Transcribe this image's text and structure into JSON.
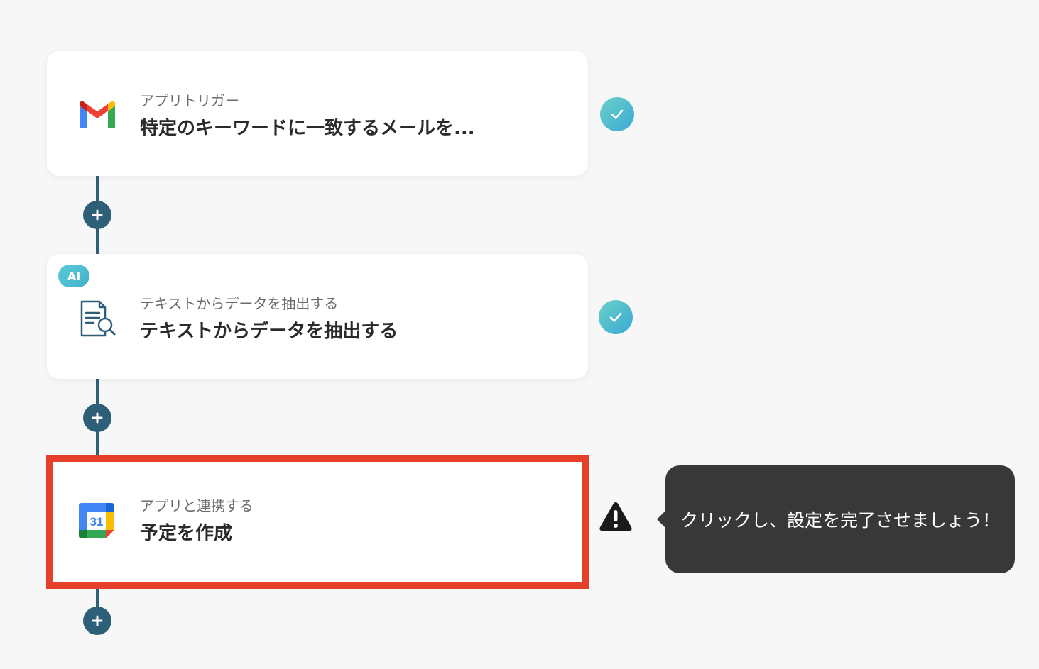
{
  "steps": [
    {
      "subtitle": "アプリトリガー",
      "title": "特定のキーワードに一致するメールを...",
      "app_icon": "gmail-icon",
      "status": "complete"
    },
    {
      "badge": "AI",
      "subtitle": "テキストからデータを抽出する",
      "title": "テキストからデータを抽出する",
      "app_icon": "document-search-icon",
      "status": "complete"
    },
    {
      "subtitle": "アプリと連携する",
      "title": "予定を作成",
      "app_icon": "google-calendar-icon",
      "calendar_day": "31",
      "status": "warning"
    }
  ],
  "tooltip": {
    "text": "クリックし、設定を完了させましょう！"
  },
  "colors": {
    "connector": "#2e5f79",
    "highlight_border": "#e5402a",
    "check_gradient_start": "#6ad1c6",
    "check_gradient_end": "#3aa9d6",
    "tooltip_bg": "#383838"
  }
}
